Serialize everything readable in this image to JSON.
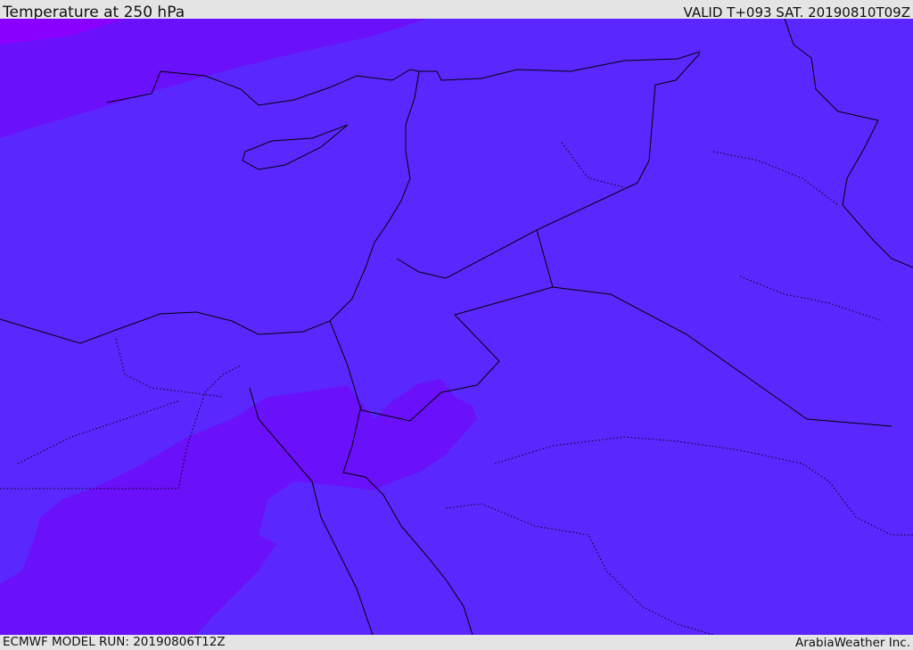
{
  "header": {
    "title": "Temperature at 250 hPa",
    "valid": "VALID T+093 SAT. 20190810T09Z"
  },
  "footer": {
    "model_run": "ECMWF MODEL RUN: 20190806T12Z",
    "credit": "ArabiaWeather Inc."
  },
  "map": {
    "variable": "temperature",
    "level": "250 hPa",
    "colors": {
      "base": "#5a28ff",
      "warmer": "#6a10fa",
      "warmest": "#8a00ff"
    }
  }
}
